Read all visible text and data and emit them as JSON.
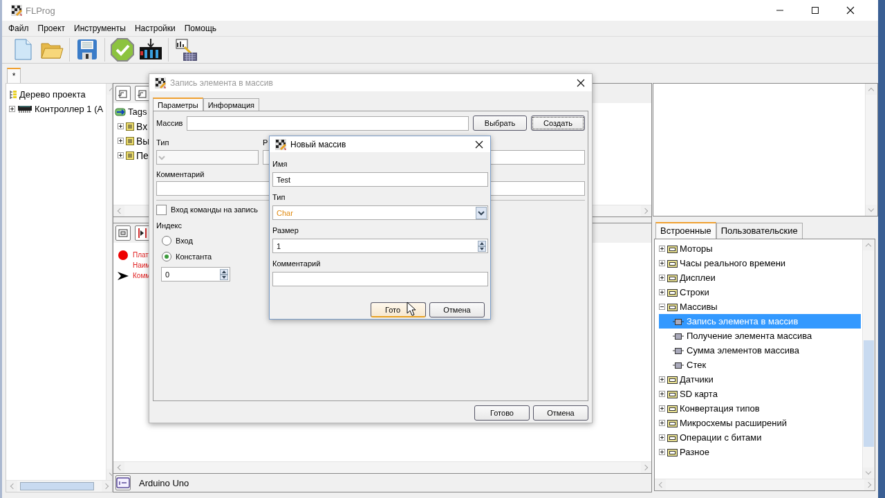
{
  "window": {
    "title": "FLProg"
  },
  "menu": [
    "Файл",
    "Проект",
    "Инструменты",
    "Настройки",
    "Помощь"
  ],
  "doc_tabs": [
    {
      "label": "*",
      "selected": true
    }
  ],
  "project_tree": {
    "title": "Дерево проекта",
    "children": [
      {
        "label": "Контроллер 1 (А",
        "expanded": false
      }
    ]
  },
  "tags_tree": {
    "title": "Tags",
    "children": [
      {
        "label": "Вх",
        "expanded": false
      },
      {
        "label": "Вы",
        "expanded": false
      },
      {
        "label": "Пе",
        "expanded": false
      }
    ]
  },
  "info_panel": {
    "lines": [
      {
        "kind": "dot",
        "text": "Плат"
      },
      {
        "kind": "none",
        "text": "Наим"
      },
      {
        "kind": "arrow",
        "text": "Комм"
      }
    ]
  },
  "library": {
    "tabs": [
      {
        "label": "Встроенные",
        "selected": true
      },
      {
        "label": "Пользовательские",
        "selected": false
      }
    ],
    "items": [
      {
        "kind": "folder",
        "label": "Моторы",
        "expanded": false,
        "selected": false
      },
      {
        "kind": "folder",
        "label": "Часы реального времени",
        "expanded": false,
        "selected": false
      },
      {
        "kind": "folder",
        "label": "Дисплеи",
        "expanded": false,
        "selected": false
      },
      {
        "kind": "folder",
        "label": "Строки",
        "expanded": false,
        "selected": false
      },
      {
        "kind": "folder",
        "label": "Массивы",
        "expanded": true,
        "selected": false,
        "children": [
          {
            "kind": "block",
            "label": "Запись элемента в массив",
            "selected": true
          },
          {
            "kind": "block",
            "label": "Получение элемента массива",
            "selected": false
          },
          {
            "kind": "block",
            "label": "Сумма элементов массива",
            "selected": false
          },
          {
            "kind": "block",
            "label": "Стек",
            "selected": false
          }
        ]
      },
      {
        "kind": "folder",
        "label": "Датчики",
        "expanded": false,
        "selected": false
      },
      {
        "kind": "folder",
        "label": "SD карта",
        "expanded": false,
        "selected": false
      },
      {
        "kind": "folder",
        "label": "Конвертация типов",
        "expanded": false,
        "selected": false
      },
      {
        "kind": "folder",
        "label": "Микросхемы расширений",
        "expanded": false,
        "selected": false
      },
      {
        "kind": "folder",
        "label": "Операции с битами",
        "expanded": false,
        "selected": false
      },
      {
        "kind": "folder",
        "label": "Разное",
        "expanded": false,
        "selected": false
      }
    ]
  },
  "status_bar": {
    "text": "Arduino Uno"
  },
  "dialog": {
    "title": "Запись элемента в массив",
    "tabs": [
      {
        "label": "Параметры",
        "selected": true
      },
      {
        "label": "Информация",
        "selected": false
      }
    ],
    "array_label": "Массив",
    "select_button": "Выбрать",
    "create_button": "Создать",
    "type_label": "Тип",
    "size_label": "Р",
    "comment_label": "Комментарий",
    "write_input": {
      "label": "Вход команды на запись",
      "checked": false
    },
    "index_label": "Индекс",
    "index_options": [
      {
        "label": "Вход",
        "selected": false
      },
      {
        "label": "Константа",
        "selected": true
      }
    ],
    "index_value": "0",
    "buttons": [
      "Готово",
      "Отмена"
    ]
  },
  "new_array_dialog": {
    "title": "Новый массив",
    "name_label": "Имя",
    "name_value": "Test",
    "type_label": "Тип",
    "type_value": "Char",
    "size_label": "Размер",
    "size_value": "1",
    "comment_label": "Комментарий",
    "buttons": [
      "Гото",
      "Отмена"
    ]
  }
}
